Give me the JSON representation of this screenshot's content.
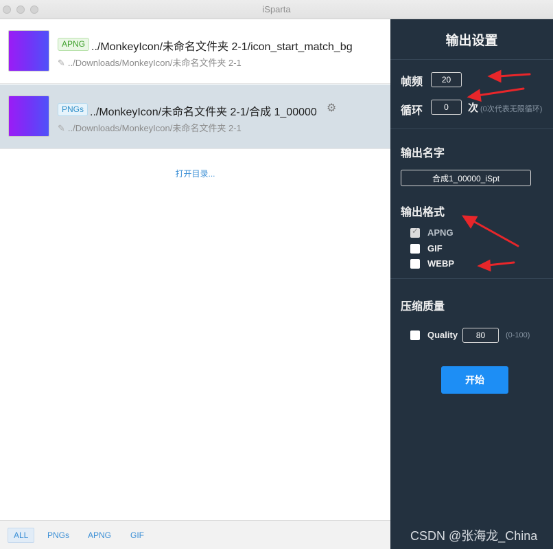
{
  "window": {
    "title": "iSparta"
  },
  "files": [
    {
      "badge": "APNG",
      "path": "../MonkeyIcon/未命名文件夹 2-1/icon_start_match_bg",
      "dest": "../Downloads/MonkeyIcon/未命名文件夹 2-1"
    },
    {
      "badge": "PNGs",
      "path": "../MonkeyIcon/未命名文件夹 2-1/合成 1_00000",
      "dest": "../Downloads/MonkeyIcon/未命名文件夹 2-1"
    }
  ],
  "open_dir": "打开目录...",
  "filters": [
    "ALL",
    "PNGs",
    "APNG",
    "GIF"
  ],
  "settings": {
    "title": "输出设置",
    "frame_rate": {
      "label": "帧频",
      "value": "20"
    },
    "loop": {
      "label": "循环",
      "value": "0",
      "unit": "次",
      "hint": "(0次代表无限循环)"
    },
    "output_name": {
      "label": "输出名字",
      "value": "合成1_00000_iSpt"
    },
    "output_format": {
      "label": "输出格式",
      "options": [
        {
          "label": "APNG",
          "checked": true
        },
        {
          "label": "GIF",
          "checked": false
        },
        {
          "label": "WEBP",
          "checked": false
        }
      ]
    },
    "quality": {
      "label": "压缩质量",
      "checkbox_label": "Quality",
      "value": "80",
      "hint": "(0-100)"
    },
    "start_button": "开始"
  },
  "watermark": "CSDN @张海龙_China",
  "colors": {
    "panel_bg": "#23313f",
    "accent": "#1d8ef5",
    "selected_row": "#d6dfe6",
    "annotation": "#e8262a"
  }
}
